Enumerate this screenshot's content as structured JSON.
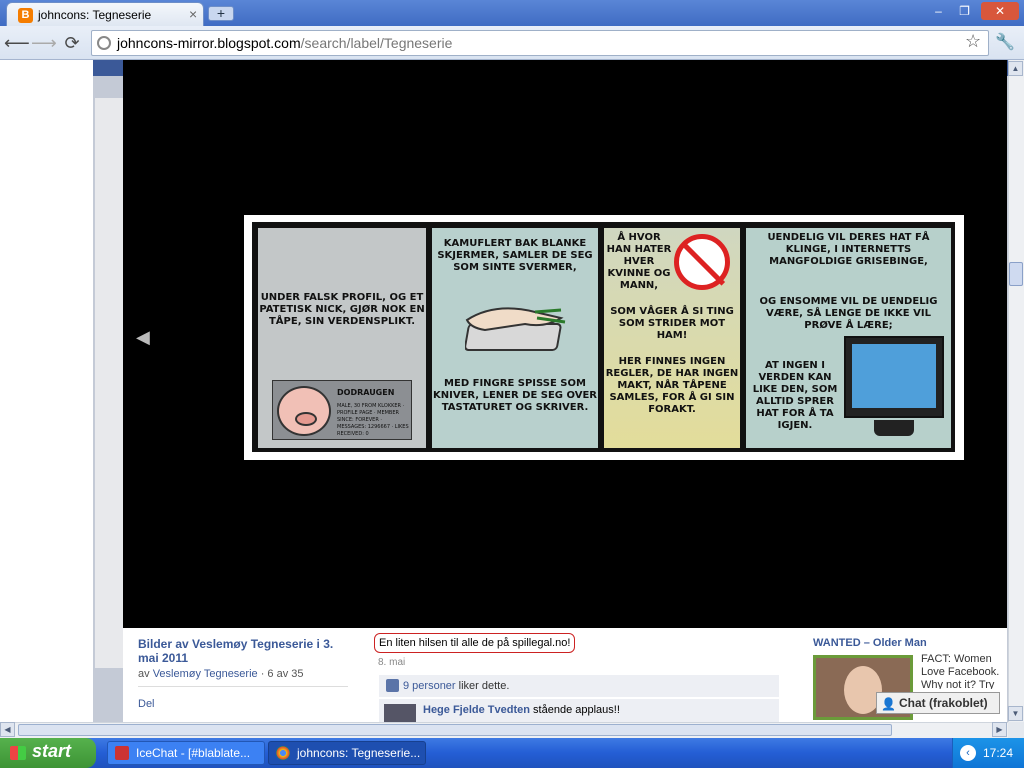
{
  "browser": {
    "tab_title": "johncons: Tegneserie",
    "tab_favicon": "B",
    "new_tab_icon": "+",
    "close_icon": "×",
    "minimize_icon": "–",
    "restore_icon": "❐",
    "window_close_icon": "✕",
    "back_icon": "⟵",
    "forward_icon": "⟶",
    "reload_icon": "⟳",
    "url_domain": "johncons-mirror.blogspot.com",
    "url_path": "/search/label/Tegneserie",
    "star_icon": "☆",
    "wrench_icon": "🔧"
  },
  "viewer": {
    "prev_arrow": "◀"
  },
  "comic": {
    "panel1_text": "Under falsk profil, og et patetisk nick, gjør nok en tåpe, sin verdensplikt.",
    "profile_name": "DODRAUGEN",
    "profile_info": "MALE, 30 FROM KLOKKER · PROFILE PAGE · MEMBER SINCE: FOREVER · MESSAGES: 1296667 · LIKES RECEIVED: 0",
    "panel2_top": "Kamuflert bak blanke skjermer, samler de seg som sinte svermer,",
    "panel2_bottom": "med fingre spisse som kniver, lener de seg over tastaturet og skriver.",
    "panel3_top": "Å hvor han hater hver kvinne og mann,",
    "panel3_mid": "som våger å si ting som strider mot ham!",
    "panel3_bottom": "Her finnes ingen regler, de har ingen makt, når tåpene samles, for å gi sin forakt.",
    "panel4_top": "Uendelig vil deres hat få klinge, i internetts mangfoldige grisebinge,",
    "panel4_mid": "og ensomme vil de uendelig være, så lenge de ikke vil prøve å lære;",
    "panel4_bottom": "at ingen i verden kan like den, som alltid sprer hat for å ta igjen."
  },
  "album": {
    "title": "Bilder av Veslemøy Tegneserie i 3. mai 2011",
    "meta_prefix": "av ",
    "meta_author": "Veslemøy Tegneserie",
    "meta_suffix": " · 6 av 35",
    "share": "Del"
  },
  "photo": {
    "caption": "En liten hilsen til alle de på spillegal.no!",
    "date": "8. mai",
    "likes_count": "9 personer",
    "likes_suffix": " liker dette.",
    "comment_author": "Hege Fjelde Tvedten",
    "comment_text": " stående applaus!!"
  },
  "ad": {
    "title": "WANTED – Older Man",
    "text": "FACT: Women Love Facebook. Why not it? Try Are You In!"
  },
  "chat": {
    "icon": "👤",
    "label": "Chat (frakoblet)"
  },
  "scroll": {
    "up": "▲",
    "down": "▼",
    "left": "◀",
    "right": "▶"
  },
  "taskbar": {
    "start_label": "start",
    "task1_label": "IceChat - [#blablate...",
    "task2_label": "johncons: Tegneserie...",
    "tray_arrow": "‹",
    "clock": "17:24"
  },
  "colors": {
    "facebook_blue": "#3b5998",
    "caption_border": "#cc2222",
    "taskbar_blue": "#245ed5",
    "start_green": "#3d9435"
  }
}
